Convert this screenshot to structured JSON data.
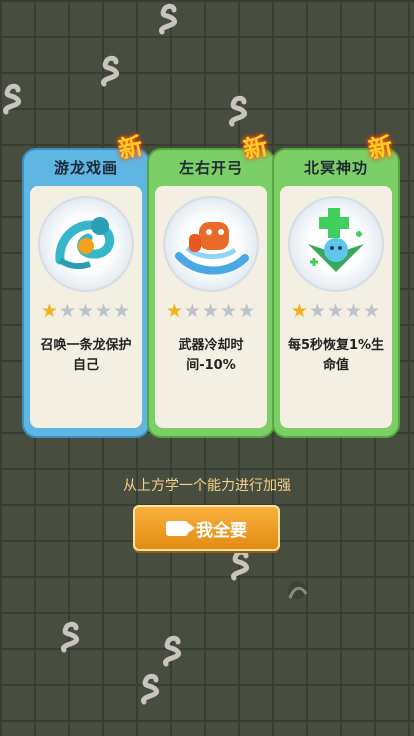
{
  "cards": [
    {
      "title": "游龙戏画",
      "new_badge": "新",
      "stars_filled": 1,
      "stars_total": 5,
      "description": "召唤一条龙保护自己",
      "icon": "dragon-icon"
    },
    {
      "title": "左右开弓",
      "new_badge": "新",
      "stars_filled": 1,
      "stars_total": 5,
      "description": "武器冷却时间-10%",
      "icon": "fist-splash-icon"
    },
    {
      "title": "北冥神功",
      "new_badge": "新",
      "stars_filled": 1,
      "stars_total": 5,
      "description": "每5秒恢复1%生命值",
      "icon": "meditating-spirit-icon"
    }
  ],
  "hint": "从上方学一个能力进行加强",
  "button": {
    "label": "我全要",
    "icon": "video-icon"
  }
}
